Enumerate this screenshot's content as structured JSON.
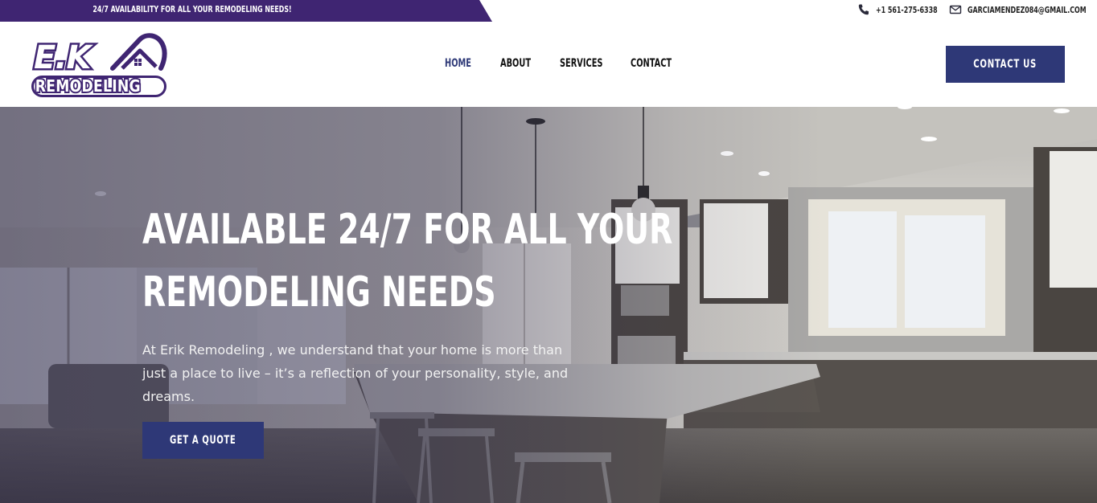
{
  "topbar": {
    "tagline": "24/7 AVAILABILITY FOR ALL YOUR REMODELING NEEDS!",
    "phone": "+1 561-275-6338",
    "email": "GARCIAMENDEZ084@GMAIL.COM",
    "ribbon_color": "#3f2572"
  },
  "logo": {
    "mark": "E.K",
    "wordmark": "REMODELING",
    "brand_color": "#3f2572"
  },
  "nav": {
    "items": [
      {
        "label": "HOME",
        "active": true
      },
      {
        "label": "ABOUT",
        "active": false
      },
      {
        "label": "SERVICES",
        "active": false
      },
      {
        "label": "CONTACT",
        "active": false
      }
    ],
    "active_color": "#2f3a78"
  },
  "header": {
    "cta_label": "CONTACT US",
    "cta_color": "#2e3877"
  },
  "hero": {
    "title_line1": "AVAILABLE 24/7 FOR ALL YOUR",
    "title_line2": "REMODELING NEEDS",
    "text": "At Erik Remodeling , we understand that your home is more than just a place to live – it’s a reflection of your personality, style, and dreams.",
    "button_label": "GET A QUOTE",
    "image_subject": "modern kitchen interior with island and pendant lights"
  },
  "icons": {
    "phone": "phone-icon",
    "email": "envelope-icon"
  }
}
